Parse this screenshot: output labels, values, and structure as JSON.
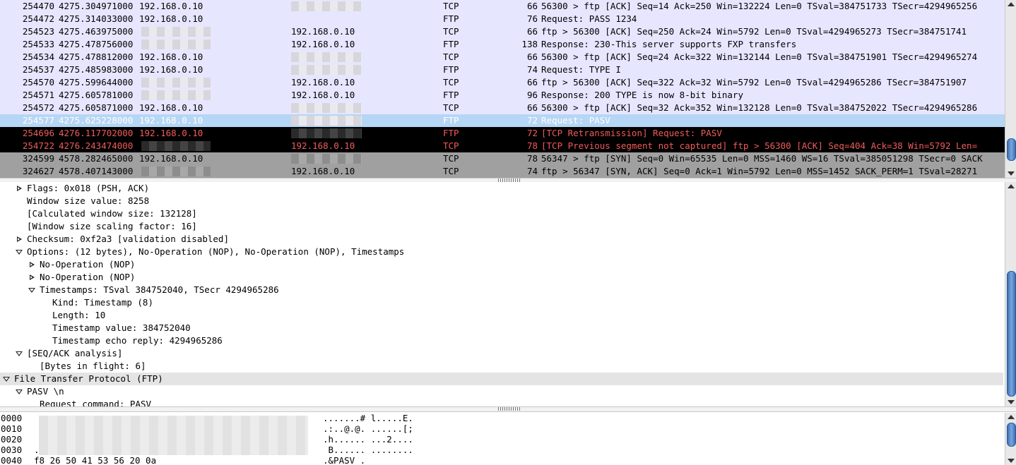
{
  "packets": [
    {
      "no": "254470",
      "time": "4275.304971000",
      "src": "192.168.0.10",
      "dst": "",
      "proto": "TCP",
      "len": "66",
      "info": "56300 > ftp [ACK] Seq=14 Ack=250 Win=132224 Len=0 TSval=384751733 TSecr=4294965256",
      "style": "normal",
      "blur": "dst"
    },
    {
      "no": "254472",
      "time": "4275.314033000",
      "src": "192.168.0.10",
      "dst": "",
      "proto": "FTP",
      "len": "76",
      "info": "Request: PASS 1234",
      "style": "normal",
      "blur": "none"
    },
    {
      "no": "254523",
      "time": "4275.463975000",
      "src": "",
      "dst": "192.168.0.10",
      "proto": "TCP",
      "len": "66",
      "info": "ftp > 56300 [ACK] Seq=250 Ack=24 Win=5792 Len=0 TSval=4294965273 TSecr=384751741",
      "style": "normal",
      "blur": "src"
    },
    {
      "no": "254533",
      "time": "4275.478756000",
      "src": "",
      "dst": "192.168.0.10",
      "proto": "FTP",
      "len": "138",
      "info": "Response: 230-This server supports FXP transfers",
      "style": "normal",
      "blur": "src"
    },
    {
      "no": "254534",
      "time": "4275.478812000",
      "src": "192.168.0.10",
      "dst": "",
      "proto": "TCP",
      "len": "66",
      "info": "56300 > ftp [ACK] Seq=24 Ack=322 Win=132144 Len=0 TSval=384751901 TSecr=4294965274",
      "style": "normal",
      "blur": "dst"
    },
    {
      "no": "254537",
      "time": "4275.485983000",
      "src": "192.168.0.10",
      "dst": "",
      "proto": "FTP",
      "len": "74",
      "info": "Request: TYPE I",
      "style": "normal",
      "blur": "dst"
    },
    {
      "no": "254570",
      "time": "4275.599644000",
      "src": "",
      "dst": "192.168.0.10",
      "proto": "TCP",
      "len": "66",
      "info": "ftp > 56300 [ACK] Seq=322 Ack=32 Win=5792 Len=0 TSval=4294965286 TSecr=384751907",
      "style": "normal",
      "blur": "src"
    },
    {
      "no": "254571",
      "time": "4275.605781000",
      "src": "",
      "dst": "192.168.0.10",
      "proto": "FTP",
      "len": "96",
      "info": "Response: 200 TYPE is now 8-bit binary",
      "style": "normal",
      "blur": "src"
    },
    {
      "no": "254572",
      "time": "4275.605871000",
      "src": "192.168.0.10",
      "dst": "",
      "proto": "TCP",
      "len": "66",
      "info": "56300 > ftp [ACK] Seq=32 Ack=352 Win=132128 Len=0 TSval=384752022 TSecr=4294965286",
      "style": "normal",
      "blur": "dst"
    },
    {
      "no": "254577",
      "time": "4275.625228000",
      "src": "192.168.0.10",
      "dst": "",
      "proto": "FTP",
      "len": "72",
      "info": "Request: PASV",
      "style": "selected",
      "blur": "dst"
    },
    {
      "no": "254696",
      "time": "4276.117702000",
      "src": "192.168.0.10",
      "dst": "",
      "proto": "FTP",
      "len": "72",
      "info": "[TCP Retransmission] Request: PASV",
      "style": "black",
      "blur": "dst"
    },
    {
      "no": "254722",
      "time": "4276.243474000",
      "src": "",
      "dst": "192.168.0.10",
      "proto": "TCP",
      "len": "78",
      "info": "[TCP Previous segment not captured] ftp > 56300 [ACK] Seq=404 Ack=38 Win=5792 Len=",
      "style": "black",
      "blur": "src"
    },
    {
      "no": "324599",
      "time": "4578.282465000",
      "src": "192.168.0.10",
      "dst": "",
      "proto": "TCP",
      "len": "78",
      "info": "56347 > ftp [SYN] Seq=0 Win=65535 Len=0 MSS=1460 WS=16 TSval=385051298 TSecr=0 SACK",
      "style": "gray",
      "blur": "dst"
    },
    {
      "no": "324627",
      "time": "4578.407143000",
      "src": "",
      "dst": "192.168.0.10",
      "proto": "TCP",
      "len": "74",
      "info": "ftp > 56347 [SYN, ACK] Seq=0 Ack=1 Win=5792 Len=0 MSS=1452 SACK_PERM=1 TSval=28271",
      "style": "gray",
      "blur": "src"
    }
  ],
  "details": [
    {
      "indent": 1,
      "toggle": "closed",
      "text": "Flags: 0x018 (PSH, ACK)",
      "hl": false
    },
    {
      "indent": 1,
      "toggle": "none",
      "text": "Window size value: 8258",
      "hl": false
    },
    {
      "indent": 1,
      "toggle": "none",
      "text": "[Calculated window size: 132128]",
      "hl": false
    },
    {
      "indent": 1,
      "toggle": "none",
      "text": "[Window size scaling factor: 16]",
      "hl": false
    },
    {
      "indent": 1,
      "toggle": "closed",
      "text": "Checksum: 0xf2a3 [validation disabled]",
      "hl": false
    },
    {
      "indent": 1,
      "toggle": "open",
      "text": "Options: (12 bytes), No-Operation (NOP), No-Operation (NOP), Timestamps",
      "hl": false
    },
    {
      "indent": 2,
      "toggle": "closed",
      "text": "No-Operation (NOP)",
      "hl": false
    },
    {
      "indent": 2,
      "toggle": "closed",
      "text": "No-Operation (NOP)",
      "hl": false
    },
    {
      "indent": 2,
      "toggle": "open",
      "text": "Timestamps: TSval 384752040, TSecr 4294965286",
      "hl": false
    },
    {
      "indent": 3,
      "toggle": "none",
      "text": "Kind: Timestamp (8)",
      "hl": false
    },
    {
      "indent": 3,
      "toggle": "none",
      "text": "Length: 10",
      "hl": false
    },
    {
      "indent": 3,
      "toggle": "none",
      "text": "Timestamp value: 384752040",
      "hl": false
    },
    {
      "indent": 3,
      "toggle": "none",
      "text": "Timestamp echo reply: 4294965286",
      "hl": false
    },
    {
      "indent": 1,
      "toggle": "open",
      "text": "[SEQ/ACK analysis]",
      "hl": false
    },
    {
      "indent": 2,
      "toggle": "none",
      "text": "[Bytes in flight: 6]",
      "hl": false
    },
    {
      "indent": 0,
      "toggle": "open",
      "text": "File Transfer Protocol (FTP)",
      "hl": true
    },
    {
      "indent": 1,
      "toggle": "open",
      "text": "PASV \\n",
      "hl": false
    },
    {
      "indent": 2,
      "toggle": "none",
      "text": "Request command: PASV",
      "hl": false
    }
  ],
  "hex": [
    {
      "offset": "0000",
      "bytes": "",
      "ascii": ".......# l.....E."
    },
    {
      "offset": "0010",
      "bytes": "",
      "ascii": ".:..@.@. ......[;"
    },
    {
      "offset": "0020",
      "bytes": "",
      "ascii": ".h...... ...2...."
    },
    {
      "offset": "0030",
      "bytes": ".",
      "ascii": " B...... ........"
    },
    {
      "offset": "0040",
      "bytes": "f8 26 50 41 53 56 20 0a",
      "ascii": ".&PASV ."
    }
  ],
  "scroll": {
    "packet_list_position": 0.85,
    "details_position": 0.55,
    "hex_position": 0.2
  },
  "colors": {
    "row_normal_bg": "#e7e6ff",
    "row_selected_bg": "#b6d6f5",
    "row_selected_fg": "#ffffff",
    "row_black_bg": "#000000",
    "row_black_fg": "#f25a5a",
    "row_gray_bg": "#a0a0a0",
    "row_gray_fg": "#000000"
  }
}
